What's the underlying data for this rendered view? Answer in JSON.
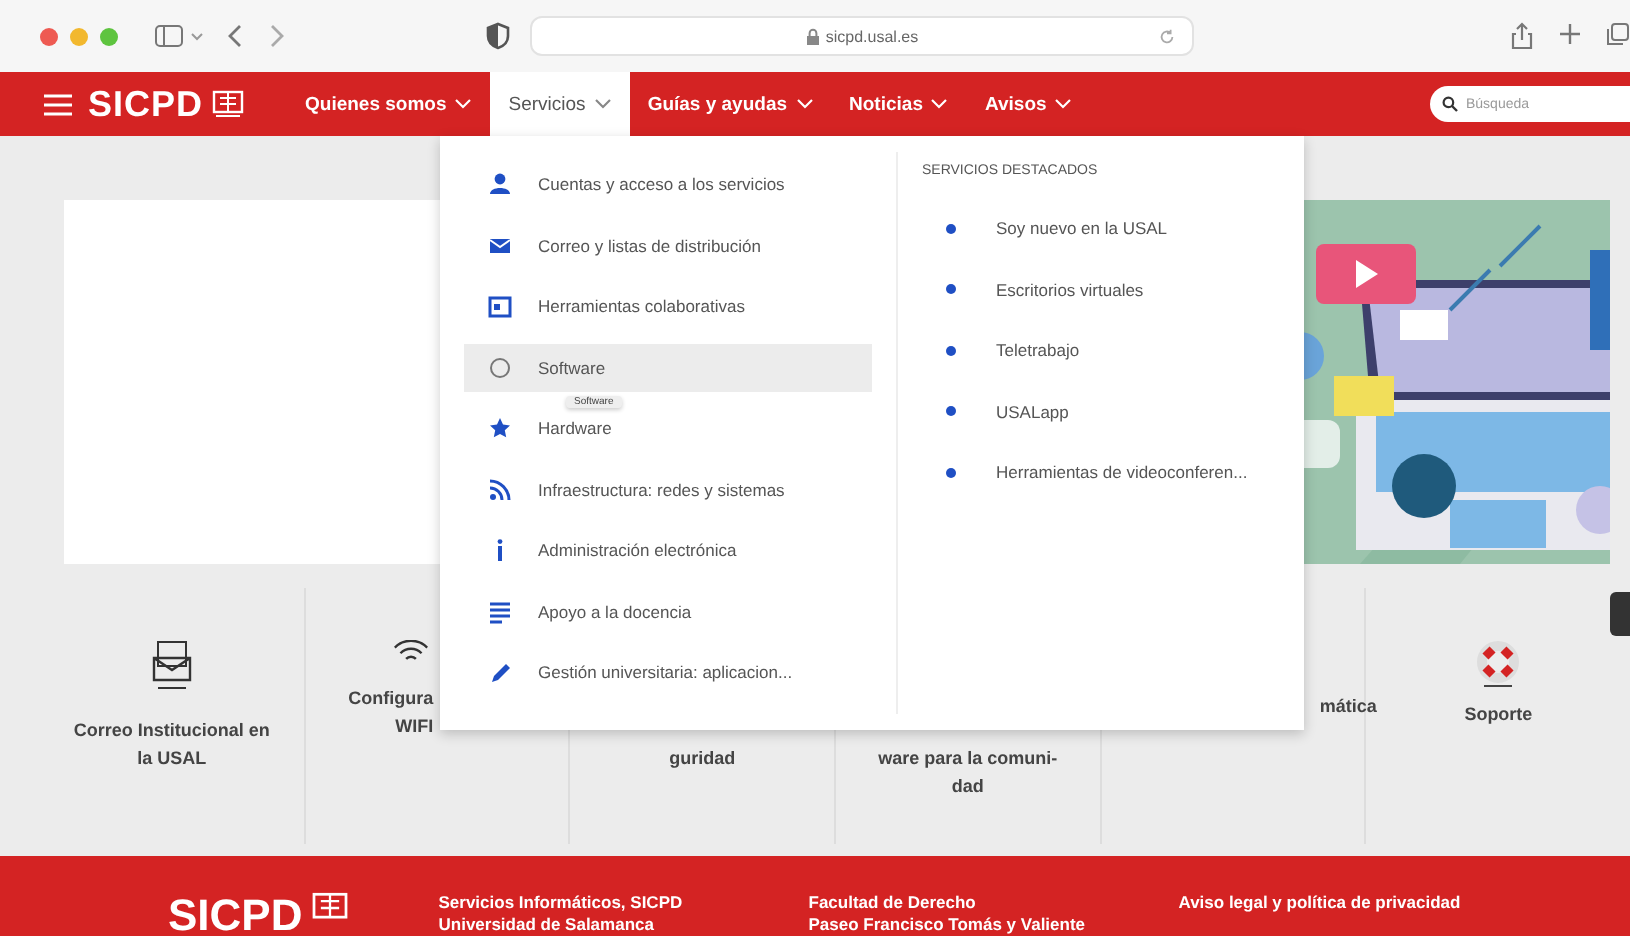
{
  "browser": {
    "url": "sicpd.usal.es"
  },
  "nav": {
    "logo": "SICPD",
    "items": [
      {
        "label": "Quienes somos",
        "selected": false
      },
      {
        "label": "Servicios",
        "selected": true
      },
      {
        "label": "Guías y ayudas",
        "selected": false
      },
      {
        "label": "Noticias",
        "selected": false
      },
      {
        "label": "Avisos",
        "selected": false
      }
    ],
    "search": {
      "placeholder": "Búsqueda"
    }
  },
  "dropdown": {
    "items": [
      {
        "label": "Cuentas y acceso a los servicios",
        "selected": false
      },
      {
        "label": "Correo y listas de distribución",
        "selected": false
      },
      {
        "label": "Herramientas colaborativas",
        "selected": false
      },
      {
        "label": "Software",
        "selected": true
      },
      {
        "label": "Hardware",
        "selected": false
      },
      {
        "label": "Infraestructura: redes y sistemas",
        "selected": false
      },
      {
        "label": "Administración electrónica",
        "selected": false
      },
      {
        "label": "Apoyo a la docencia",
        "selected": false
      },
      {
        "label": "Gestión universitaria: aplicacion...",
        "selected": false
      }
    ],
    "tooltip": "Software",
    "featured_heading": "SERVICIOS DESTACADOS",
    "featured": [
      "Soy nuevo en la USAL",
      "Escritorios virtuales",
      "Teletrabajo",
      "USALapp",
      "Herramientas de videoconferen..."
    ]
  },
  "cards": [
    {
      "lines": [
        "Correo Institucional en",
        "la USAL"
      ]
    },
    {
      "lines": [
        "Configura",
        "WIFI"
      ]
    },
    {
      "lines": [
        "guridad"
      ]
    },
    {
      "lines": [
        "ware para la comuni-",
        "dad"
      ]
    },
    {
      "lines": [
        "mática"
      ]
    },
    {
      "lines": [
        "Soporte"
      ]
    }
  ],
  "footer": {
    "logo": "SICPD",
    "columns": [
      [
        "Servicios Informáticos, SICPD",
        "Universidad de Salamanca"
      ],
      [
        "Facultad de Derecho",
        "Paseo Francisco Tomás y Valiente"
      ],
      [
        "Aviso legal y política de privacidad"
      ]
    ]
  }
}
